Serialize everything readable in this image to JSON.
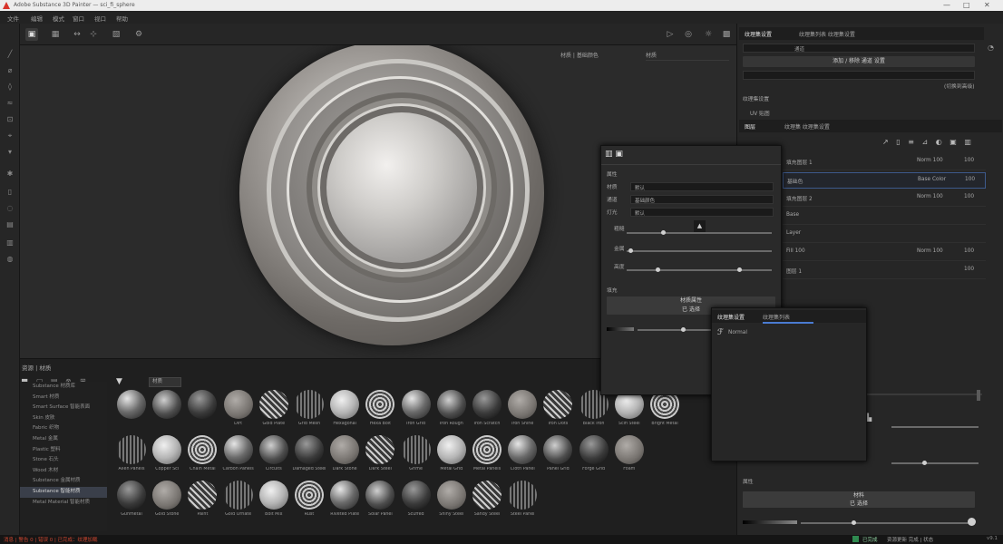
{
  "titlebar": {
    "title": "Adobe Substance 3D Painter — sci_fi_sphere",
    "controls": [
      "—",
      "□",
      "✕"
    ]
  },
  "menu": [
    "文件",
    "编辑",
    "模式",
    "窗口",
    "视口",
    "帮助"
  ],
  "left_tools": [
    "paint-icon",
    "eraser-icon",
    "projection-icon",
    "smudge-icon",
    "clone-icon",
    "picker-icon",
    "fill-icon",
    "select-icon",
    "polygon-icon",
    "bake-icon",
    "layers-icon",
    "history-icon"
  ],
  "top_toolbar": {
    "tools": [
      "layout-icon",
      "transform-icon",
      "move-icon",
      "symmetry-icon",
      "camera-icon",
      "gear-icon"
    ],
    "right_tools": [
      "render-icon",
      "camera2-icon",
      "display-icon",
      "screenshot-icon"
    ]
  },
  "viewport": {
    "dropdown_left": "材质 | 基础颜色",
    "dropdown_right": "材质"
  },
  "shelf": {
    "header": "资源 | 材质",
    "filter_label": "材质",
    "tree": [
      "Substance 材质库",
      "Smart 材质",
      "Smart Surface 智能表面",
      "Skin 皮肤",
      "Fabric 织物",
      "Metal 金属",
      "Plastic 塑料",
      "Stone 石头",
      "Wood 木材",
      "Substance 金属材质",
      "Substance 智能材质",
      "Metal Material 智能材质"
    ],
    "selected_index": 10,
    "row1": [
      "",
      "",
      "",
      "Dirt",
      "Gold Plate",
      "Grid Mesh",
      "Hexagonal",
      "Hexa Bolt",
      "Iron Grid",
      "Iron Rough",
      "Iron Scratch",
      "Iron Shine",
      "Iron Dots",
      "Black Iron",
      "Scifi Steel",
      "Bright Metal"
    ],
    "row2": [
      "Alien Panels",
      "Copper Sci",
      "Chain Metal",
      "Carbon Panels",
      "Circuits",
      "Damaged Steel",
      "Dark Stone",
      "Dark Steel",
      "Grime",
      "Metal Grid",
      "Metal Panels",
      "Cloth Panel",
      "Panel Grid",
      "Forge Grid",
      "Foam"
    ],
    "row3": [
      "Gunmetal",
      "Gold Stone",
      "Paint",
      "Gold Ornate",
      "Bolt Mix",
      "Rust",
      "Riveted Plate",
      "Solar Panel",
      "Scuffed",
      "Shiny Steel",
      "Sandy Steel",
      "Steel Panel"
    ]
  },
  "right_panel": {
    "top_tabs": [
      "纹理集设置",
      "纹理集列表 纹理集设置"
    ],
    "material_field": "通道",
    "button1": "添加 / 移除 通道 设置",
    "link1": "(切换到高级)",
    "section_resolution": "纹理集设置",
    "subtab1": "UV 贴图",
    "layer_tabs": [
      "图层",
      "纹理集 纹理集设置"
    ],
    "layer_items": [
      {
        "name": "填充图层 1",
        "value": "Norm 100",
        "extra": "100"
      },
      {
        "name": "基础色",
        "value": "Base Color",
        "extra": "100"
      },
      {
        "name": "填充图层 2",
        "value": "Norm 100",
        "extra": "100"
      },
      {
        "name": "Base",
        "value": "",
        "extra": ""
      },
      {
        "name": "Layer",
        "value": "",
        "extra": ""
      },
      {
        "name": "Fill 100",
        "value": "Norm 100",
        "extra": "100"
      },
      {
        "name": "图层 1",
        "value": "",
        "extra": "100"
      }
    ],
    "bottom_section": "属性",
    "bottom_button": "材料",
    "bottom_button2": "已 选择"
  },
  "float_window": {
    "section1": "属性",
    "fields": [
      {
        "label": "材质",
        "value": "默认"
      },
      {
        "label": "通道",
        "value": "基础颜色"
      },
      {
        "label": "灯光",
        "value": "默认"
      }
    ],
    "sliders": [
      "粗糙",
      "金属",
      "高度"
    ],
    "section2": "填充",
    "button": "材质属性",
    "button_sub": "已 选择"
  },
  "float_window2": {
    "tabs": [
      "纹理集设置",
      "纹理集列表"
    ],
    "item": "Normal"
  },
  "statusbar": {
    "left": "消息 | 警告 0 | 错误 0 | 已完成：纹理加载",
    "right_label": "已完成",
    "right": "资源更新 完成 | 状态",
    "version": "v9.1"
  },
  "colors": {
    "accent": "#4a7bd1",
    "warning": "#d0402c",
    "ok": "#2f8a50"
  }
}
